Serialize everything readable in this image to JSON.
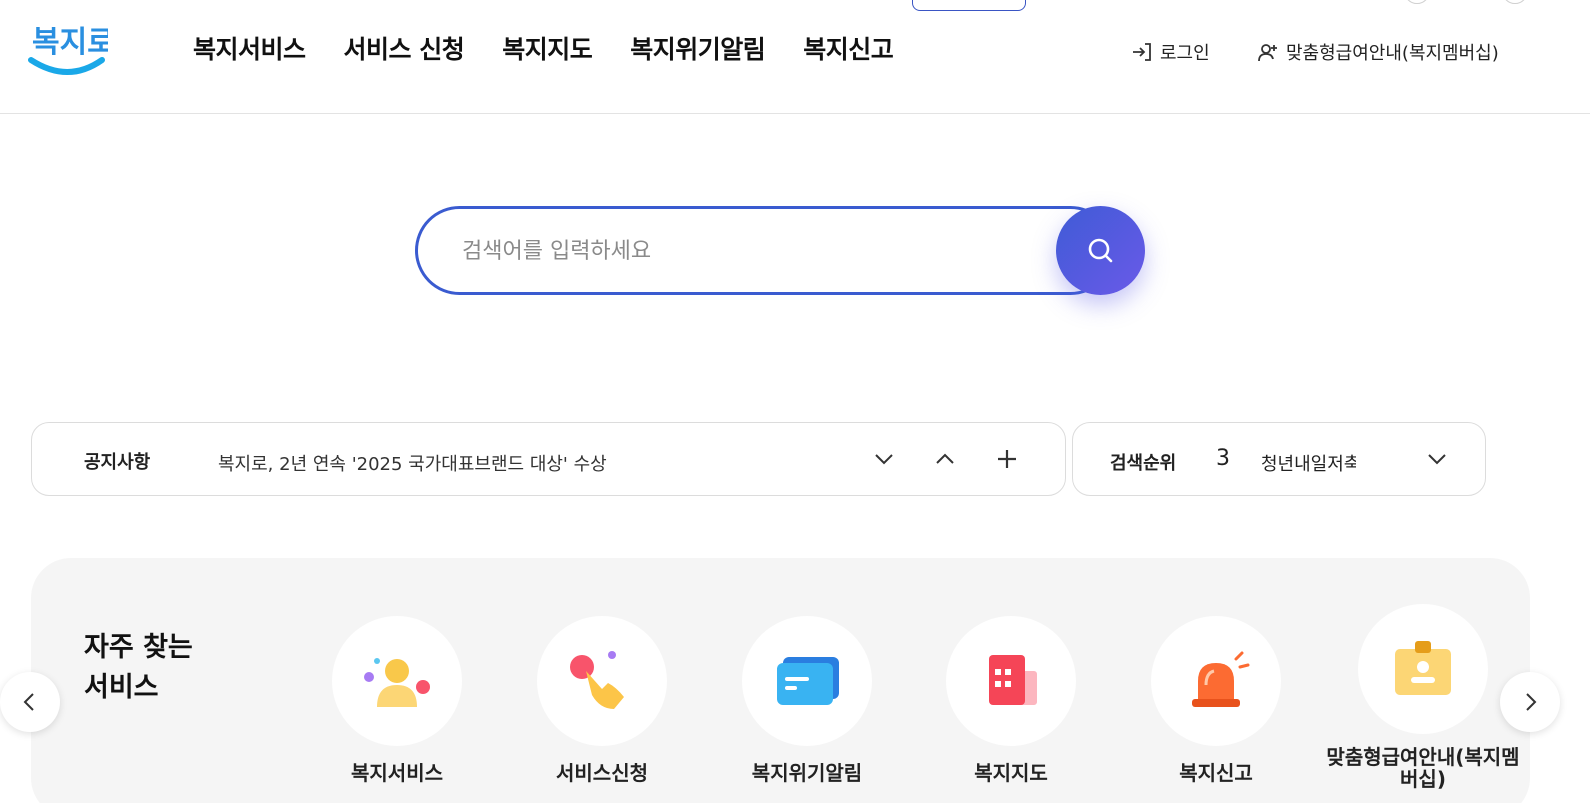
{
  "header": {
    "logo_text": "복지로",
    "nav": [
      "복지서비스",
      "서비스 신청",
      "복지지도",
      "복지위기알림",
      "복지신고"
    ],
    "login_label": "로그인",
    "membership_label": "맞춤형급여안내(복지멤버십)"
  },
  "search": {
    "placeholder": "검색어를 입력하세요"
  },
  "notice": {
    "label": "공지사항",
    "text": "복지로, 2년 연속 '2025 국가대표브랜드 대상' 수상"
  },
  "ranking": {
    "label": "검색순위",
    "rank": "3",
    "term": "청년내일저축"
  },
  "frequent": {
    "title_line1": "자주 찾는",
    "title_line2": "서비스",
    "items": [
      {
        "label": "복지서비스",
        "icon": "person-icon"
      },
      {
        "label": "서비스신청",
        "icon": "hand-pointer-icon"
      },
      {
        "label": "복지위기알림",
        "icon": "message-card-icon"
      },
      {
        "label": "복지지도",
        "icon": "building-map-icon"
      },
      {
        "label": "복지신고",
        "icon": "siren-icon"
      },
      {
        "label": "맞춤형급여안내(복지멤버십)",
        "icon": "id-badge-icon"
      }
    ]
  },
  "colors": {
    "accent": "#3a5bd0",
    "search_button_start": "#3f5bd6",
    "search_button_end": "#6a5ae8",
    "section_bg": "#f5f5f5"
  }
}
